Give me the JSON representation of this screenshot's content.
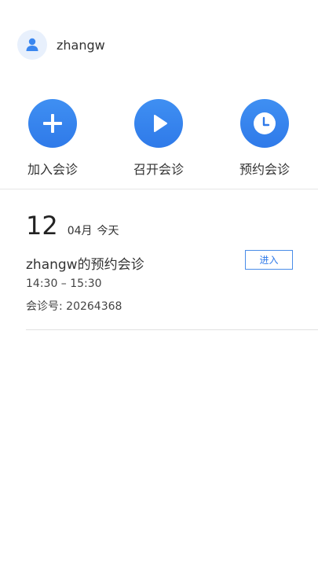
{
  "profile": {
    "avatar_icon": "user-icon",
    "username": "zhangw"
  },
  "actions": [
    {
      "icon": "plus-icon",
      "label": "加入会诊"
    },
    {
      "icon": "play-icon",
      "label": "召开会诊"
    },
    {
      "icon": "clock-icon",
      "label": "预约会诊"
    }
  ],
  "schedule": {
    "day": "12",
    "month": "04月",
    "relative_day": "今天",
    "meetings": [
      {
        "title": "zhangw的预约会诊",
        "time": "14:30 – 15:30",
        "id_text": "会诊号: 20264368",
        "enter_label": "进入"
      }
    ]
  },
  "colors": {
    "accent": "#2f7ae9",
    "avatar_bg": "#e8f0fc",
    "text": "#333333"
  }
}
